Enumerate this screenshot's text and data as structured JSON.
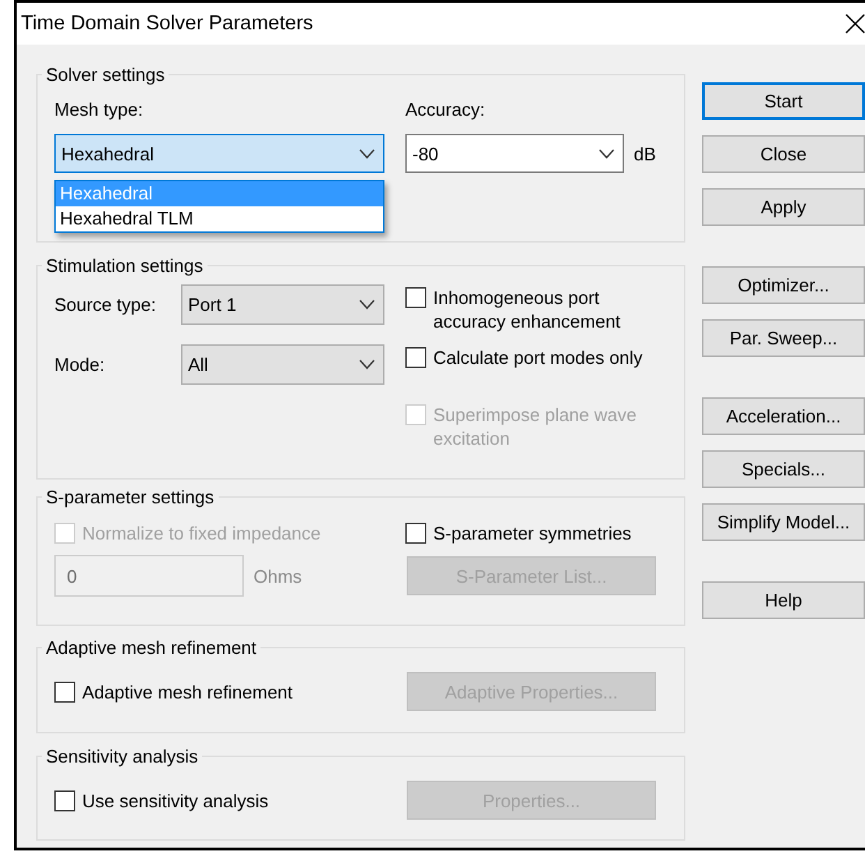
{
  "window": {
    "title": "Time Domain Solver Parameters"
  },
  "solver_settings": {
    "title": "Solver settings",
    "mesh_type": {
      "label": "Mesh type:",
      "value": "Hexahedral",
      "focused": true,
      "expanded": true,
      "options": [
        {
          "label": "Hexahedral",
          "selected": true
        },
        {
          "label": "Hexahedral TLM",
          "selected": false
        }
      ]
    },
    "accuracy": {
      "label": "Accuracy:",
      "value": "-80",
      "unit": "dB",
      "focused": false
    }
  },
  "stimulation_settings": {
    "title": "Stimulation settings",
    "fields": [
      {
        "label": "Source type:",
        "value": "Port 1"
      },
      {
        "label": "Mode:",
        "value": "All"
      }
    ],
    "checkboxes": [
      {
        "label": "Inhomogeneous port accuracy enhancement",
        "checked": false,
        "disabled": false
      },
      {
        "label": "Calculate port modes only",
        "checked": false,
        "disabled": false
      },
      {
        "label": "Superimpose plane wave excitation",
        "checked": false,
        "disabled": true
      }
    ]
  },
  "s_parameter_settings": {
    "title": "S-parameter settings",
    "normalize": {
      "label": "Normalize to fixed impedance",
      "checked": false,
      "disabled": true
    },
    "symmetries": {
      "label": "S-parameter symmetries",
      "checked": false,
      "disabled": false
    },
    "impedance": {
      "value": "0",
      "unit": "Ohms",
      "disabled": true
    },
    "button": {
      "label": "S-Parameter List...",
      "disabled": true
    }
  },
  "adaptive_mesh_refinement": {
    "title": "Adaptive mesh refinement",
    "checkbox": {
      "label": "Adaptive mesh refinement",
      "checked": false,
      "disabled": false
    },
    "button": {
      "label": "Adaptive Properties...",
      "disabled": true
    }
  },
  "sensitivity_analysis": {
    "title": "Sensitivity analysis",
    "checkbox": {
      "label": "Use sensitivity analysis",
      "checked": false,
      "disabled": false
    },
    "button": {
      "label": "Properties...",
      "disabled": true
    }
  },
  "button_groups": [
    [
      {
        "label": "Start",
        "default": true
      },
      {
        "label": "Close",
        "default": false
      },
      {
        "label": "Apply",
        "default": false
      }
    ],
    [
      {
        "label": "Optimizer...",
        "default": false
      },
      {
        "label": "Par. Sweep...",
        "default": false
      }
    ],
    [
      {
        "label": "Acceleration...",
        "default": false
      },
      {
        "label": "Specials...",
        "default": false
      },
      {
        "label": "Simplify Model...",
        "default": false
      }
    ],
    [
      {
        "label": "Help",
        "default": false
      }
    ]
  ]
}
